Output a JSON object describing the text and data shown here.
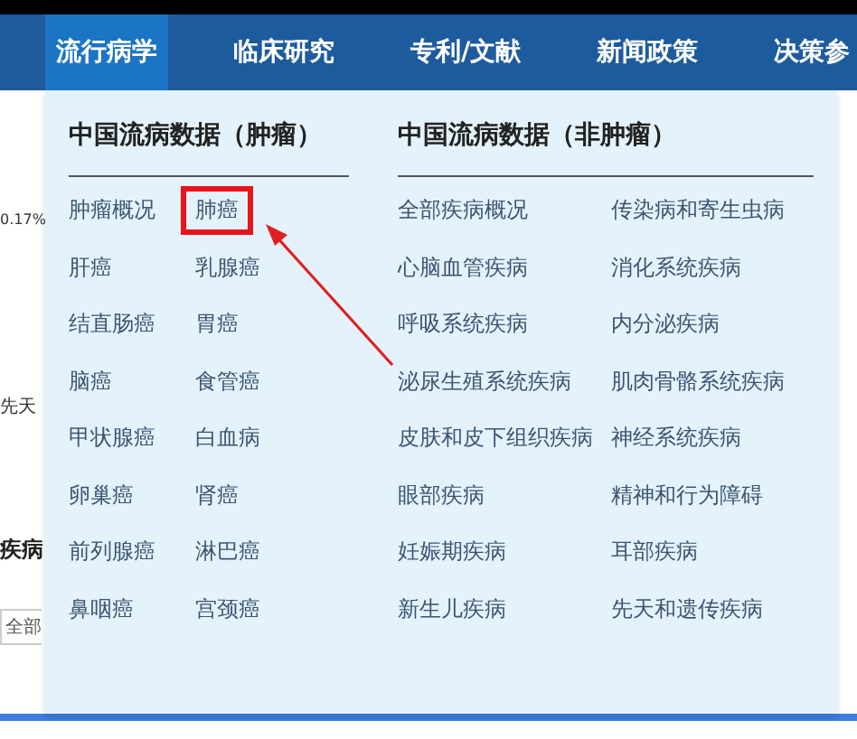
{
  "nav": {
    "tabs": [
      {
        "label": "流行病学",
        "selected": true
      },
      {
        "label": "临床研究",
        "selected": false
      },
      {
        "label": "专利/文献",
        "selected": false
      },
      {
        "label": "新闻政策",
        "selected": false
      },
      {
        "label": "决策参",
        "selected": false
      }
    ]
  },
  "background": {
    "texts": [
      {
        "kind": "value",
        "text": "0.17%"
      },
      {
        "kind": "note",
        "text": "先天"
      },
      {
        "kind": "heading",
        "text": "疾病"
      },
      {
        "kind": "field",
        "text": "全部"
      }
    ]
  },
  "dropdown": {
    "sections": [
      {
        "title": "中国流病数据（肿瘤）",
        "items": [
          {
            "label": "肿瘤概况",
            "highlighted": false
          },
          {
            "label": "肺癌",
            "highlighted": true
          },
          {
            "label": "肝癌",
            "highlighted": false
          },
          {
            "label": "乳腺癌",
            "highlighted": false
          },
          {
            "label": "结直肠癌",
            "highlighted": false
          },
          {
            "label": "胃癌",
            "highlighted": false
          },
          {
            "label": "脑癌",
            "highlighted": false
          },
          {
            "label": "食管癌",
            "highlighted": false
          },
          {
            "label": "甲状腺癌",
            "highlighted": false
          },
          {
            "label": "白血病",
            "highlighted": false
          },
          {
            "label": "卵巢癌",
            "highlighted": false
          },
          {
            "label": "肾癌",
            "highlighted": false
          },
          {
            "label": "前列腺癌",
            "highlighted": false
          },
          {
            "label": "淋巴癌",
            "highlighted": false
          },
          {
            "label": "鼻咽癌",
            "highlighted": false
          },
          {
            "label": "宫颈癌",
            "highlighted": false
          }
        ]
      },
      {
        "title": "中国流病数据（非肿瘤）",
        "items": [
          {
            "label": "全部疾病概况",
            "highlighted": false
          },
          {
            "label": "传染病和寄生虫病",
            "highlighted": false
          },
          {
            "label": "心脑血管疾病",
            "highlighted": false
          },
          {
            "label": "消化系统疾病",
            "highlighted": false
          },
          {
            "label": "呼吸系统疾病",
            "highlighted": false
          },
          {
            "label": "内分泌疾病",
            "highlighted": false
          },
          {
            "label": "泌尿生殖系统疾病",
            "highlighted": false
          },
          {
            "label": "肌肉骨骼系统疾病",
            "highlighted": false
          },
          {
            "label": "皮肤和皮下组织疾病",
            "highlighted": false
          },
          {
            "label": "神经系统疾病",
            "highlighted": false
          },
          {
            "label": "眼部疾病",
            "highlighted": false
          },
          {
            "label": "精神和行为障碍",
            "highlighted": false
          },
          {
            "label": "妊娠期疾病",
            "highlighted": false
          },
          {
            "label": "耳部疾病",
            "highlighted": false
          },
          {
            "label": "新生儿疾病",
            "highlighted": false
          },
          {
            "label": "先天和遗传疾病",
            "highlighted": false
          }
        ]
      }
    ]
  }
}
